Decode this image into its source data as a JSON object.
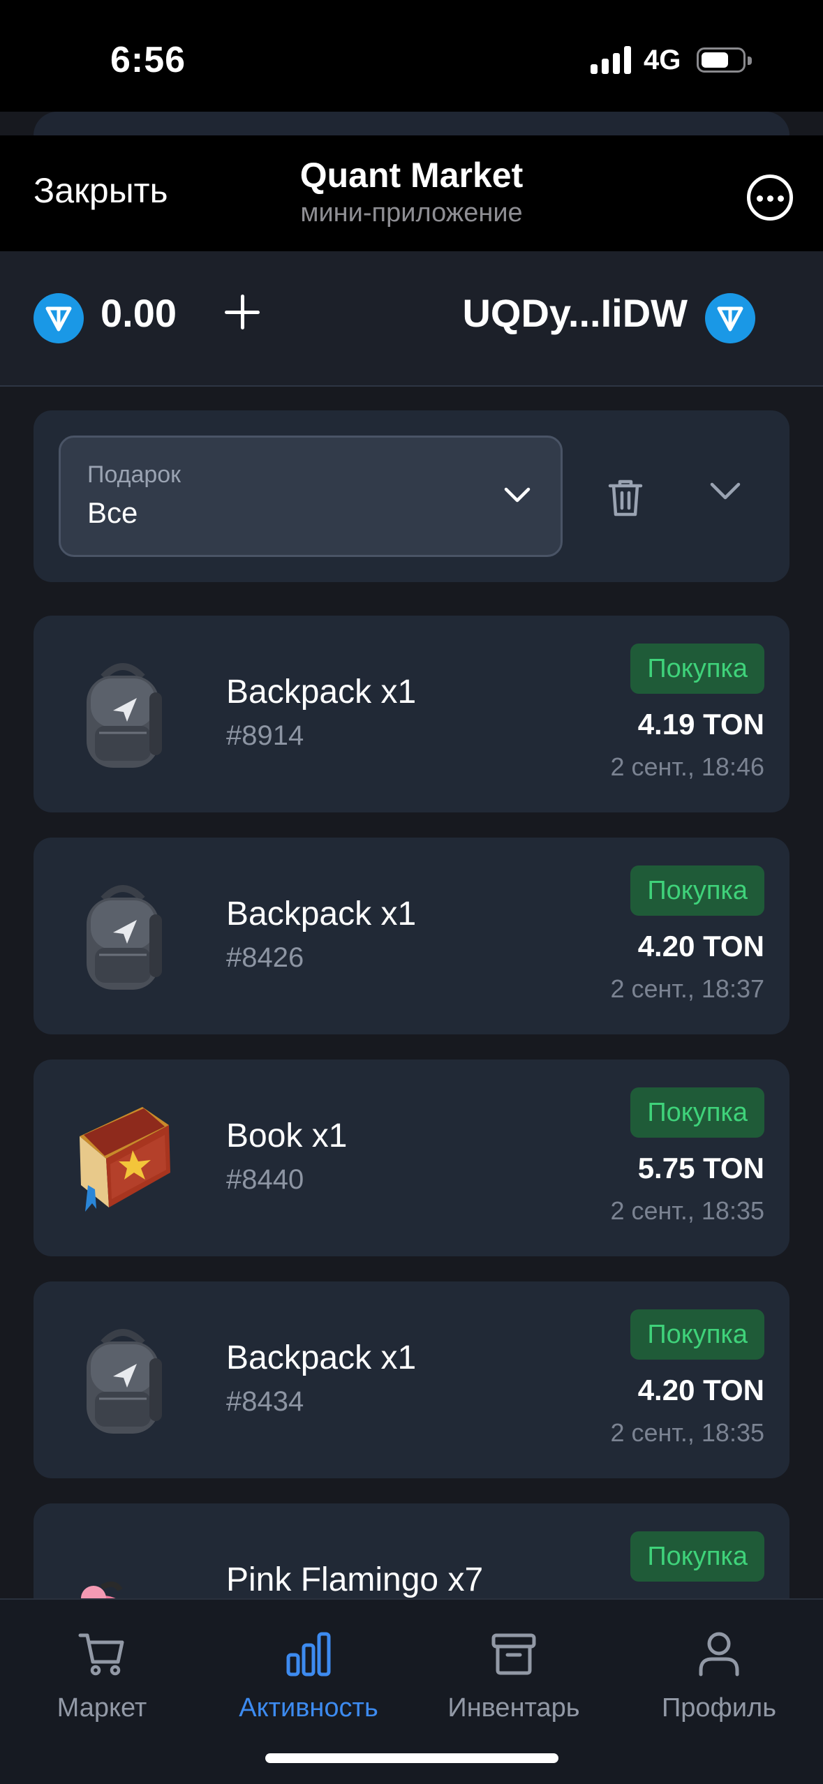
{
  "status_bar": {
    "time": "6:56",
    "network": "4G"
  },
  "header": {
    "close_label": "Закрыть",
    "title": "Quant Market",
    "subtitle": "мини-приложение"
  },
  "wallet": {
    "balance": "0.00",
    "address": "UQDy...IiDW"
  },
  "filter": {
    "label": "Подарок",
    "value": "Все"
  },
  "activities": [
    {
      "name": "Backpack x1",
      "number": "#8914",
      "type": "Покупка",
      "price": "4.19 TON",
      "date": "2 сент., 18:46",
      "icon": "backpack"
    },
    {
      "name": "Backpack x1",
      "number": "#8426",
      "type": "Покупка",
      "price": "4.20 TON",
      "date": "2 сент., 18:37",
      "icon": "backpack"
    },
    {
      "name": "Book x1",
      "number": "#8440",
      "type": "Покупка",
      "price": "5.75 TON",
      "date": "2 сент., 18:35",
      "icon": "book"
    },
    {
      "name": "Backpack x1",
      "number": "#8434",
      "type": "Покупка",
      "price": "4.20 TON",
      "date": "2 сент., 18:35",
      "icon": "backpack"
    },
    {
      "name": "Pink Flamingo x7",
      "number": "",
      "type": "Покупка",
      "price": "",
      "date": "",
      "icon": "flamingo"
    }
  ],
  "nav": [
    {
      "label": "Маркет",
      "icon": "cart-icon",
      "active": false
    },
    {
      "label": "Активность",
      "icon": "bar-chart-icon",
      "active": true
    },
    {
      "label": "Инвентарь",
      "icon": "archive-box-icon",
      "active": false
    },
    {
      "label": "Профиль",
      "icon": "user-icon",
      "active": false
    }
  ],
  "colors": {
    "accent": "#3d8bf0",
    "badge_bg": "#1f5b38",
    "badge_text": "#3fd27a",
    "ton": "#1a98e6"
  }
}
